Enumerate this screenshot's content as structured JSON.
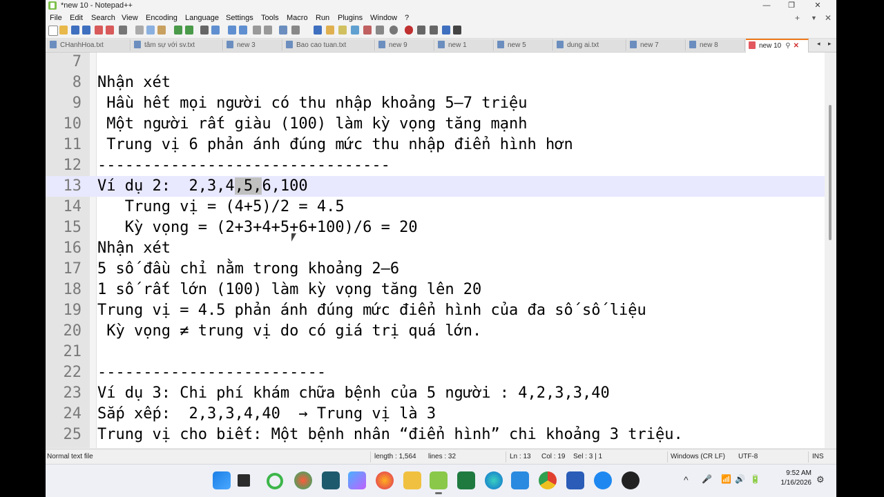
{
  "window": {
    "title": "*new 10 - Notepad++",
    "controls": {
      "minimize": "—",
      "maximize": "❐",
      "close": "✕"
    }
  },
  "menu": {
    "items": [
      "File",
      "Edit",
      "Search",
      "View",
      "Encoding",
      "Language",
      "Settings",
      "Tools",
      "Macro",
      "Run",
      "Plugins",
      "Window",
      "?"
    ],
    "right": {
      "add": "+",
      "dropdown": "▼",
      "close": "✕"
    }
  },
  "tabs": [
    {
      "label": "CHanhHoa.txt",
      "active": false
    },
    {
      "label": "tâm sự với sv.txt",
      "active": false
    },
    {
      "label": "new 3",
      "active": false
    },
    {
      "label": "Bao cao tuan.txt",
      "active": false
    },
    {
      "label": "new 9",
      "active": false
    },
    {
      "label": "new 1",
      "active": false
    },
    {
      "label": "new 5",
      "active": false
    },
    {
      "label": "dung ai.txt",
      "active": false
    },
    {
      "label": "new 7",
      "active": false
    },
    {
      "label": "new 8",
      "active": false
    },
    {
      "label": "new 10",
      "active": true
    }
  ],
  "editor": {
    "current_line": 13,
    "lines": [
      {
        "num": "7",
        "text": ""
      },
      {
        "num": "8",
        "text": "Nhận xét"
      },
      {
        "num": "9",
        "text": " Hầu hết mọi người có thu nhập khoảng 5–7 triệu"
      },
      {
        "num": "10",
        "text": " Một người rất giàu (100) làm kỳ vọng tăng mạnh"
      },
      {
        "num": "11",
        "text": " Trung vị 6 phản ánh đúng mức thu nhập điển hình hơn"
      },
      {
        "num": "12",
        "text": "--------------------------------"
      },
      {
        "num": "13",
        "text_before": "Ví dụ 2:  2,3,4",
        "text_selected": ",5,",
        "text_after": "6,100"
      },
      {
        "num": "14",
        "text": "   Trung vị = (4+5)/2 = 4.5"
      },
      {
        "num": "15",
        "text": "   Kỳ vọng = (2+3+4+5+6+100)/6 = 20"
      },
      {
        "num": "16",
        "text": "Nhận xét"
      },
      {
        "num": "17",
        "text": "5 số đầu chỉ nằm trong khoảng 2–6"
      },
      {
        "num": "18",
        "text": "1 số rất lớn (100) làm kỳ vọng tăng lên 20"
      },
      {
        "num": "19",
        "text": "Trung vị = 4.5 phản ánh đúng mức điển hình của đa số số liệu"
      },
      {
        "num": "20",
        "text": " Kỳ vọng ≠ trung vị do có giá trị quá lớn."
      },
      {
        "num": "21",
        "text": ""
      },
      {
        "num": "22",
        "text": "-------------------------"
      },
      {
        "num": "23",
        "text": "Ví dụ 3: Chi phí khám chữa bệnh của 5 người : 4,2,3,3,40"
      },
      {
        "num": "24",
        "text": "Sắp xếp:  2,3,3,4,40  → Trung vị là 3"
      },
      {
        "num": "25",
        "text": "Trung vị cho biết: Một bệnh nhân “điển hình” chi khoảng 3 triệu."
      }
    ]
  },
  "status": {
    "file_type": "Normal text file",
    "length": "length : 1,564",
    "lines": "lines : 32",
    "ln": "Ln : 13",
    "col": "Col : 19",
    "sel": "Sel : 3 | 1",
    "eol": "Windows (CR LF)",
    "encoding": "UTF-8",
    "mode": "INS"
  },
  "taskbar": {
    "apps": [
      "windows-start",
      "task-view",
      "copilot",
      "edge-dev",
      "terminal",
      "copilot-app",
      "firefox",
      "file-explorer",
      "notepad-plus-plus",
      "excel",
      "edge",
      "vscode",
      "chrome",
      "word",
      "zalo",
      "obs"
    ],
    "tray": {
      "chevron": "^",
      "mic": "🎤",
      "wifi": "📶",
      "volume": "🔊",
      "battery": "🔋"
    },
    "time": "9:52 AM",
    "date": "1/16/2026"
  }
}
